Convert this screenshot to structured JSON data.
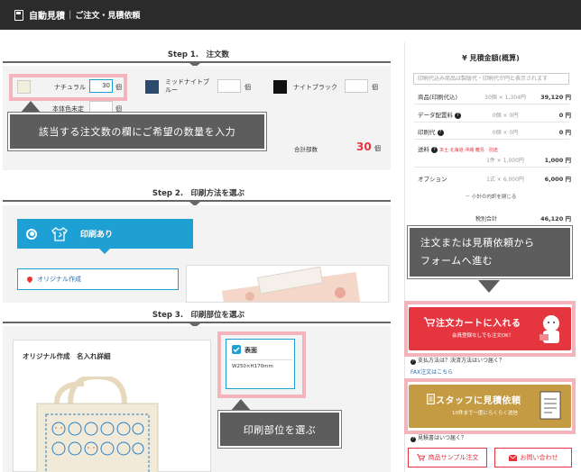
{
  "header": {
    "title": "自動見積",
    "separator": "|",
    "subtitle": "ご注文・見積依頼"
  },
  "step1": {
    "title": "Step 1.　注文数",
    "colors": [
      {
        "name": "ナチュラル",
        "qty": "30",
        "unit": "個",
        "swatch": "#f1efdc"
      },
      {
        "name": "ミッドナイトブ\nルー",
        "qty": "",
        "unit": "個",
        "swatch": "#2c4a6b"
      },
      {
        "name": "ナイトブラック",
        "qty": "",
        "unit": "個",
        "swatch": "#111111"
      }
    ],
    "undecided": {
      "name": "本体色未定",
      "unit": "個"
    },
    "total_label": "合計部数",
    "total_value": "30",
    "total_unit": "個",
    "callout": "該当する注文数の欄にご希望の数量を入力"
  },
  "step2": {
    "title": "Step 2.　印刷方法を選ぶ",
    "tab_label": "印刷あり",
    "option_label": "オリジナル作成"
  },
  "step3": {
    "title": "Step 3.　印刷部位を選ぶ",
    "card_title": "オリジナル作成　名入れ詳細",
    "part_label": "表面",
    "part_size": "W250×H170mm",
    "callout": "印刷部位を選ぶ"
  },
  "estimate": {
    "title": "¥ 見積金額(概算)",
    "note": "印刷代込み商品は製版代・印刷代が円と表示されます",
    "rows": [
      {
        "label": "商品(印刷代込)",
        "detail": "30個 × 1,304円",
        "amount": "39,120 円"
      },
      {
        "label": "データ配置料",
        "detail": "0個 × 0円",
        "amount": "0 円",
        "help": true
      },
      {
        "label": "印刷代",
        "detail": "0個 × 0円",
        "amount": "0 円",
        "help": true
      },
      {
        "label": "送料",
        "detail": "1件 × 1,000円",
        "amount": "1,000 円",
        "help": true,
        "note": "本土·北海道·沖縄·離島　別途"
      },
      {
        "label": "オプション",
        "detail": "1式 × 6,000円",
        "amount": "6,000 円"
      }
    ],
    "breakdown_toggle": "－ 小計の内訳を閉じる",
    "subtotal_label": "税別合計",
    "subtotal_value": "46,120 円"
  },
  "callout_form": {
    "line1": "注文または見積依頼から",
    "line2": "フォームへ進む"
  },
  "cart_button": {
    "label": "注文カートに入れる",
    "sub": "会員登録なしでも注文OK！"
  },
  "cart_links": [
    "支払方法は？決済方法はいつ届く？",
    "FAX注文はこちら"
  ],
  "estimate_button": {
    "label": "スタッフに見積依頼",
    "sub": "10件まで一度にらくらく送信"
  },
  "estimate_link": "見積書はいつ届く？",
  "bottom_buttons": {
    "sample": "商品サンプル注文",
    "contact": "お問い合わせ"
  },
  "colors": {
    "accent_red": "#e5363f",
    "accent_blue": "#1ea0d5",
    "gold": "#c49b43",
    "highlight_pink": "#f4b4bb"
  }
}
